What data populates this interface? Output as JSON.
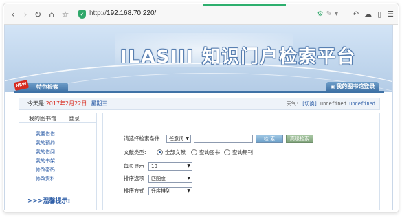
{
  "browser": {
    "url_scheme": "http://",
    "url_host": "192.168.70.220/",
    "nav_icons": [
      "back-icon",
      "forward-icon",
      "reload-icon",
      "home-icon",
      "star-icon"
    ],
    "right_icons": [
      "undo-icon",
      "cloud-icon",
      "reader-icon",
      "menu-icon"
    ],
    "accent_color": "#2eaf6e"
  },
  "banner": {
    "title": "ILASIII 知识门户检索平台"
  },
  "tabs": {
    "feature_badge": "NEW",
    "feature_label": "特色检索",
    "login_label": "我的图书馆登录"
  },
  "date_bar": {
    "today_prefix": "今天是:",
    "date": "2017年2月22日",
    "weekday": "星期三",
    "weather_prefix": "天气:",
    "weather_switch": "[切换]",
    "weather_value1": "undefined",
    "weather_value2": "undefined"
  },
  "sidebar": {
    "tab_mylib": "我的图书馆",
    "tab_login": "登录",
    "links": [
      "我要借借",
      "我的预约",
      "我的借阅",
      "我的书架",
      "修改密码",
      "修改资料"
    ],
    "tips": ">>>温馨提示:"
  },
  "search_form": {
    "condition_label": "请选择检索条件:",
    "condition_value": "任意词",
    "query_value": "",
    "search_button": "检 索",
    "advanced_button": "高级检索",
    "doc_type_label": "文献类型:",
    "doc_types": [
      "全部文献",
      "查询图书",
      "查询期刊"
    ],
    "doc_type_selected": 0,
    "per_page_label": "每页显示",
    "per_page_value": "10",
    "sort_label": "排序选项",
    "sort_value": "匹配度",
    "order_label": "排序方式",
    "order_value": "升序排列"
  },
  "colors": {
    "date_red": "#d8291c",
    "link_blue": "#2f5fa8",
    "tab_blue": "#3f72a6"
  }
}
